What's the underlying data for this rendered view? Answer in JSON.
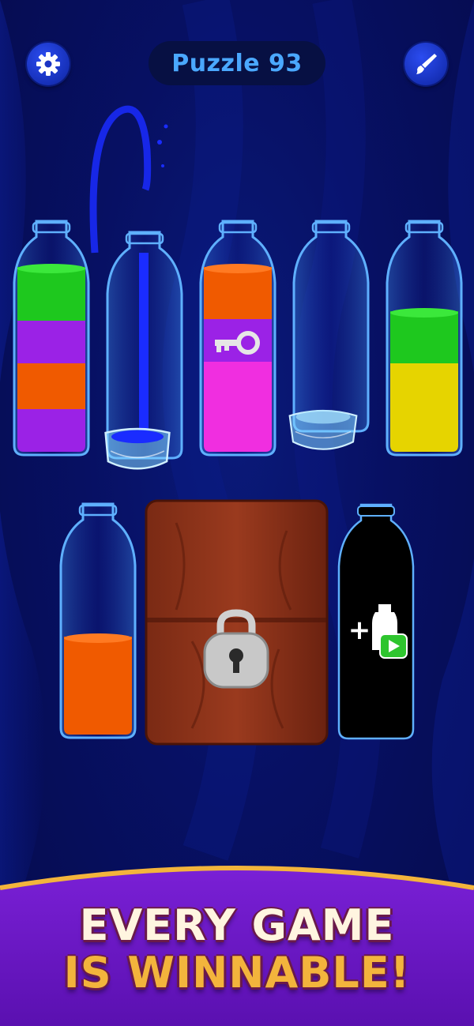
{
  "header": {
    "title": "Puzzle 93",
    "settings_icon": "gear-icon",
    "theme_icon": "paintbrush-icon"
  },
  "colors": {
    "green": "#1ec81e",
    "purple": "#9b22e6",
    "orange": "#f05a00",
    "pink": "#f02ee0",
    "yellow": "#e6d400",
    "blue_water": "#1a2cff"
  },
  "bottles": [
    {
      "name": "bottle-1",
      "layers": [
        "green",
        "purple",
        "orange",
        "purple"
      ],
      "state": "normal"
    },
    {
      "name": "bottle-2",
      "layers": [],
      "state": "frozen-pouring"
    },
    {
      "name": "bottle-3",
      "layers": [
        "orange",
        "purple",
        "pink"
      ],
      "state": "key-inside",
      "icon": "key-icon"
    },
    {
      "name": "bottle-4",
      "layers": [],
      "state": "frozen"
    },
    {
      "name": "bottle-5",
      "layers": [
        "green",
        "yellow"
      ],
      "state": "normal"
    },
    {
      "name": "bottle-6",
      "layers": [
        "orange"
      ],
      "state": "normal"
    }
  ],
  "chest": {
    "icon": "padlock-icon",
    "state": "locked"
  },
  "add_bottle": {
    "icon": "add-bottle-video-icon",
    "plus": "+"
  },
  "banner": {
    "line1": "EVERY GAME",
    "line2": "IS WINNABLE!"
  }
}
